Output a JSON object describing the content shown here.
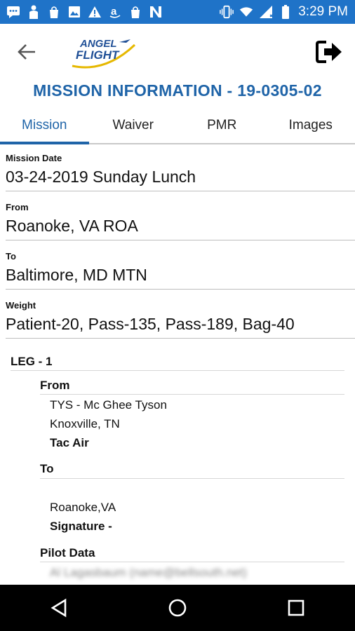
{
  "status_bar": {
    "time": "3:29 PM",
    "icons": [
      "message-icon",
      "person-icon",
      "shopping-bag-icon",
      "image-icon",
      "warning-icon",
      "amazon-icon",
      "shopping-bag-icon",
      "n-icon",
      "vibrate-icon",
      "wifi-icon",
      "signal-icon",
      "battery-icon"
    ]
  },
  "app_bar": {
    "logo_line1": "ANGEL",
    "logo_line2": "FLIGHT",
    "back_icon": "arrow-left-icon",
    "logout_icon": "logout-icon"
  },
  "page_title": "MISSION INFORMATION -  19-0305-02",
  "tabs": [
    {
      "label": "Mission",
      "active": true
    },
    {
      "label": "Waiver",
      "active": false
    },
    {
      "label": "PMR",
      "active": false
    },
    {
      "label": "Images",
      "active": false
    }
  ],
  "fields": {
    "mission_date": {
      "label": "Mission Date",
      "value": "03-24-2019  Sunday  Lunch"
    },
    "from": {
      "label": "From",
      "value": "Roanoke, VA ROA"
    },
    "to": {
      "label": "To",
      "value": "Baltimore, MD MTN"
    },
    "weight": {
      "label": "Weight",
      "value": "Patient-20, Pass-135, Pass-189, Bag-40"
    }
  },
  "leg": {
    "title": "LEG - 1",
    "from_label": "From",
    "from_line1": "TYS - Mc Ghee Tyson",
    "from_line2": "Knoxville, TN",
    "from_line3": "Tac Air",
    "to_label": "To",
    "to_line1": "Roanoke,VA",
    "signature": "Signature -",
    "pilot_label": "Pilot Data",
    "pilot_email": "Al Lagasbaum (name@bellsouth.net)"
  },
  "colors": {
    "status_bar": "#1f73c8",
    "accent": "#1f64a8",
    "logo_gold": "#e6b800"
  }
}
